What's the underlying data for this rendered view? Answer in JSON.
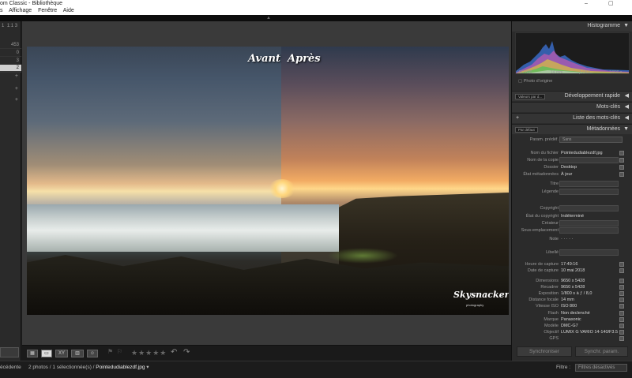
{
  "window": {
    "title": "om Classic - Bibliothèque",
    "controls": [
      "–",
      "▢"
    ]
  },
  "menu": [
    "s",
    "Affichage",
    "Fenêtre",
    "Aide"
  ],
  "left_panel": {
    "header": [
      "1",
      "1:1",
      "3"
    ],
    "counts": [
      "453",
      "0",
      "3",
      "1",
      "2"
    ],
    "plus": [
      "+",
      "+",
      "+"
    ]
  },
  "photo": {
    "before_label": "Avant",
    "after_label": "Après",
    "watermark": "Skysnacker",
    "watermark_sub": "photography"
  },
  "toolbar": {
    "stars": "★★★★★",
    "rotate_left": "↶",
    "rotate_right": "↷"
  },
  "right_panel": {
    "histogram": {
      "title": "Histogramme",
      "iso": "ISO 800",
      "focal": "14 mm",
      "aperture": "ƒ / 8.0",
      "shutter": "1/800 s",
      "original": "Photo d'origine"
    },
    "quick_develop": {
      "preset": "Valeurs par d...",
      "title": "Développement rapide"
    },
    "keywords": {
      "title": "Mots-clés"
    },
    "keyword_list": {
      "plus": "+",
      "title": "Liste des mots-clés"
    },
    "metadata": {
      "preset_select": "Par défaut",
      "title": "Métadonnées",
      "preset_label": "Param. prédéf.",
      "preset_value": "Sans",
      "rows": [
        {
          "k": "Nom du fichier",
          "v": "Pointedudiablezdf.jpg"
        },
        {
          "k": "Nom de la copie",
          "v": ""
        },
        {
          "k": "Dossier",
          "v": "Desktop"
        },
        {
          "k": "État métadonnées",
          "v": "À jour"
        },
        {
          "k": "Titre",
          "v": ""
        },
        {
          "k": "Légende",
          "v": ""
        },
        {
          "k": "Copyright",
          "v": ""
        },
        {
          "k": "État du copyright",
          "v": "Indéterminé"
        },
        {
          "k": "Créateur",
          "v": ""
        },
        {
          "k": "Sous-emplacement",
          "v": ""
        },
        {
          "k": "Note",
          "v": "·  ·  ·  ·  ·"
        },
        {
          "k": "Libellé",
          "v": ""
        },
        {
          "k": "Heure de capture",
          "v": "17:49:16"
        },
        {
          "k": "Date de capture",
          "v": "10 mai 2018"
        },
        {
          "k": "Dimensions",
          "v": "9650 x 5428"
        },
        {
          "k": "Recadrer",
          "v": "9650 x 5428"
        },
        {
          "k": "Exposition",
          "v": "1/800 s à ƒ / 8,0"
        },
        {
          "k": "Distance focale",
          "v": "14 mm"
        },
        {
          "k": "Vitesse ISO",
          "v": "ISO 800"
        },
        {
          "k": "Flash",
          "v": "Non declenché"
        },
        {
          "k": "Marque",
          "v": "Panasonic"
        },
        {
          "k": "Modèle",
          "v": "DMC-G7"
        },
        {
          "k": "Objectif",
          "v": "LUMIX G VARIO 14-140/F3.5"
        },
        {
          "k": "GPS",
          "v": ""
        }
      ]
    },
    "sync_left": "Synchroniser",
    "sync_right": "Synchr. param."
  },
  "filmstrip": {
    "prev": "écédente",
    "info": "2 photos / 1 sélectionnée(s) /",
    "filename": "Pointedudiablezdf.jpg",
    "filter_label": "Filtre :",
    "filter_value": "Filtres désactivés"
  }
}
